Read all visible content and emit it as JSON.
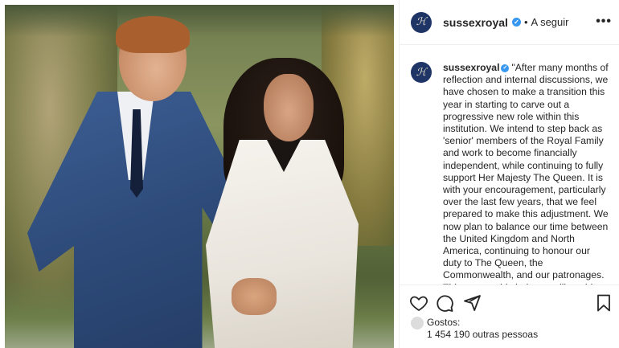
{
  "post": {
    "username": "sussexroyal",
    "separator": "•",
    "follow_label": "A seguir",
    "more_label": "•••",
    "avatar_glyph": "ℋ"
  },
  "caption": {
    "username": "sussexroyal",
    "text": "\"After many months of reflection and internal discussions, we have chosen to make a transition this year in starting to carve out a progressive new role within this institution. We intend to step back as 'senior' members of the Royal Family and work to become financially independent, while continuing to fully support Her Majesty The Queen. It is with your encouragement, particularly over the last few years, that we feel prepared to make this adjustment. We now plan to balance our time between the United Kingdom and North America, continuing to honour our duty to The Queen, the Commonwealth, and our patronages. This geographic balance will enable us"
  },
  "likes": {
    "prefix": "Gostos:",
    "count_text": "1 454 190 outras pessoas"
  },
  "icons": {
    "like": "heart-icon",
    "comment": "comment-icon",
    "share": "share-icon",
    "save": "bookmark-icon",
    "verified": "verified-badge-icon"
  },
  "colors": {
    "verified": "#3897f0",
    "avatar_bg": "#1f3566",
    "text": "#262626",
    "muted": "#8e8e8e"
  }
}
